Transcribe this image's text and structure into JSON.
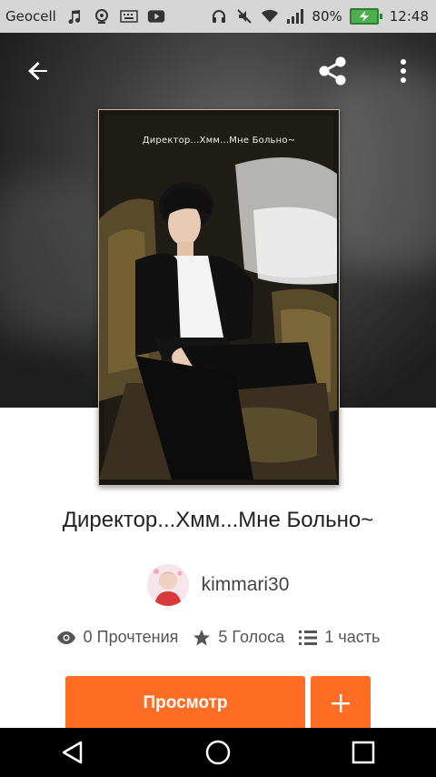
{
  "status_bar": {
    "carrier": "Geocell",
    "battery": "80%",
    "time": "12:48",
    "icons_left": [
      "music-note-icon",
      "location-icon",
      "keyboard-icon",
      "youtube-icon"
    ],
    "icons_right": [
      "headphones-icon",
      "mute-icon",
      "wifi-icon",
      "signal-icon",
      "battery-icon"
    ]
  },
  "toolbar": {
    "back_icon": "arrow-left-icon",
    "share_icon": "share-icon",
    "more_icon": "more-vertical-icon"
  },
  "cover": {
    "title": "Директор...Хмм...Мне Больно~"
  },
  "story": {
    "title": "Директор...Хмм...Мне Больно~",
    "author": "kimmari30"
  },
  "stats": {
    "reads": "0 Прочтения",
    "votes": "5 Голоса",
    "parts": "1 часть"
  },
  "actions": {
    "read_label": "Просмотр",
    "add_label": "+"
  },
  "colors": {
    "accent": "#ff6d24",
    "status_bar_bg": "#d5d5d5",
    "nav_bar_bg": "#000000"
  }
}
